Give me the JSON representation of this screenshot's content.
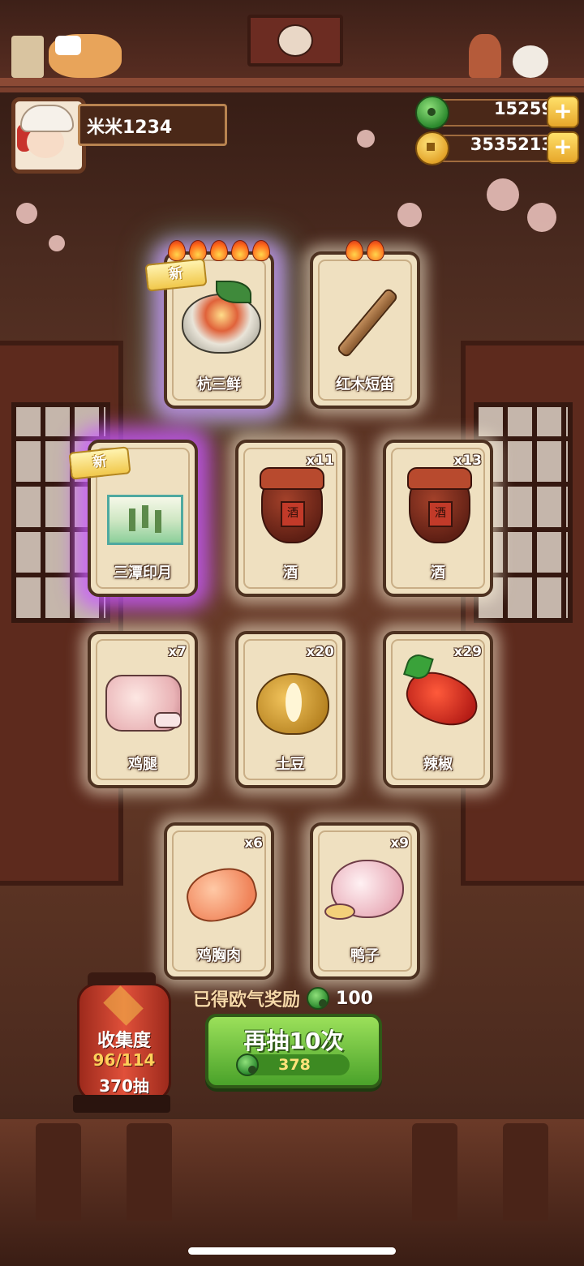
{
  "player": {
    "name": "米米1234"
  },
  "currency": {
    "jade": "15259",
    "coins": "3535213"
  },
  "cards": [
    {
      "label": "杭三鲜",
      "count": "",
      "is_new": true,
      "new_label": "新",
      "flames": 5,
      "art": "seafood-bowl"
    },
    {
      "label": "红木短笛",
      "count": "",
      "is_new": false,
      "new_label": "",
      "flames": 2,
      "art": "flute"
    },
    {
      "label": "三潭印月",
      "count": "",
      "is_new": true,
      "new_label": "新",
      "flames": 0,
      "art": "painting"
    },
    {
      "label": "酒",
      "count": "x11",
      "is_new": false,
      "new_label": "",
      "flames": 0,
      "art": "wine-jar"
    },
    {
      "label": "酒",
      "count": "x13",
      "is_new": false,
      "new_label": "",
      "flames": 0,
      "art": "wine-jar"
    },
    {
      "label": "鸡腿",
      "count": "x7",
      "is_new": false,
      "new_label": "",
      "flames": 0,
      "art": "drumstick"
    },
    {
      "label": "土豆",
      "count": "x20",
      "is_new": false,
      "new_label": "",
      "flames": 0,
      "art": "potato"
    },
    {
      "label": "辣椒",
      "count": "x29",
      "is_new": false,
      "new_label": "",
      "flames": 0,
      "art": "chili"
    },
    {
      "label": "鸡胸肉",
      "count": "x6",
      "is_new": false,
      "new_label": "",
      "flames": 0,
      "art": "chicken-breast"
    },
    {
      "label": "鸭子",
      "count": "x9",
      "is_new": false,
      "new_label": "",
      "flames": 0,
      "art": "duck"
    }
  ],
  "jar_char": "酒",
  "reward": {
    "text": "已得欧气奖励",
    "value": "100"
  },
  "draw_button": {
    "label": "再抽10次",
    "cost": "378"
  },
  "collection": {
    "title": "收集度",
    "progress": "96/114",
    "draws": "370抽"
  },
  "colors": {
    "jade": "#2c8a2e",
    "coin": "#e3a42a",
    "draw_button": "#6fc23e",
    "lantern": "#d2432f"
  }
}
